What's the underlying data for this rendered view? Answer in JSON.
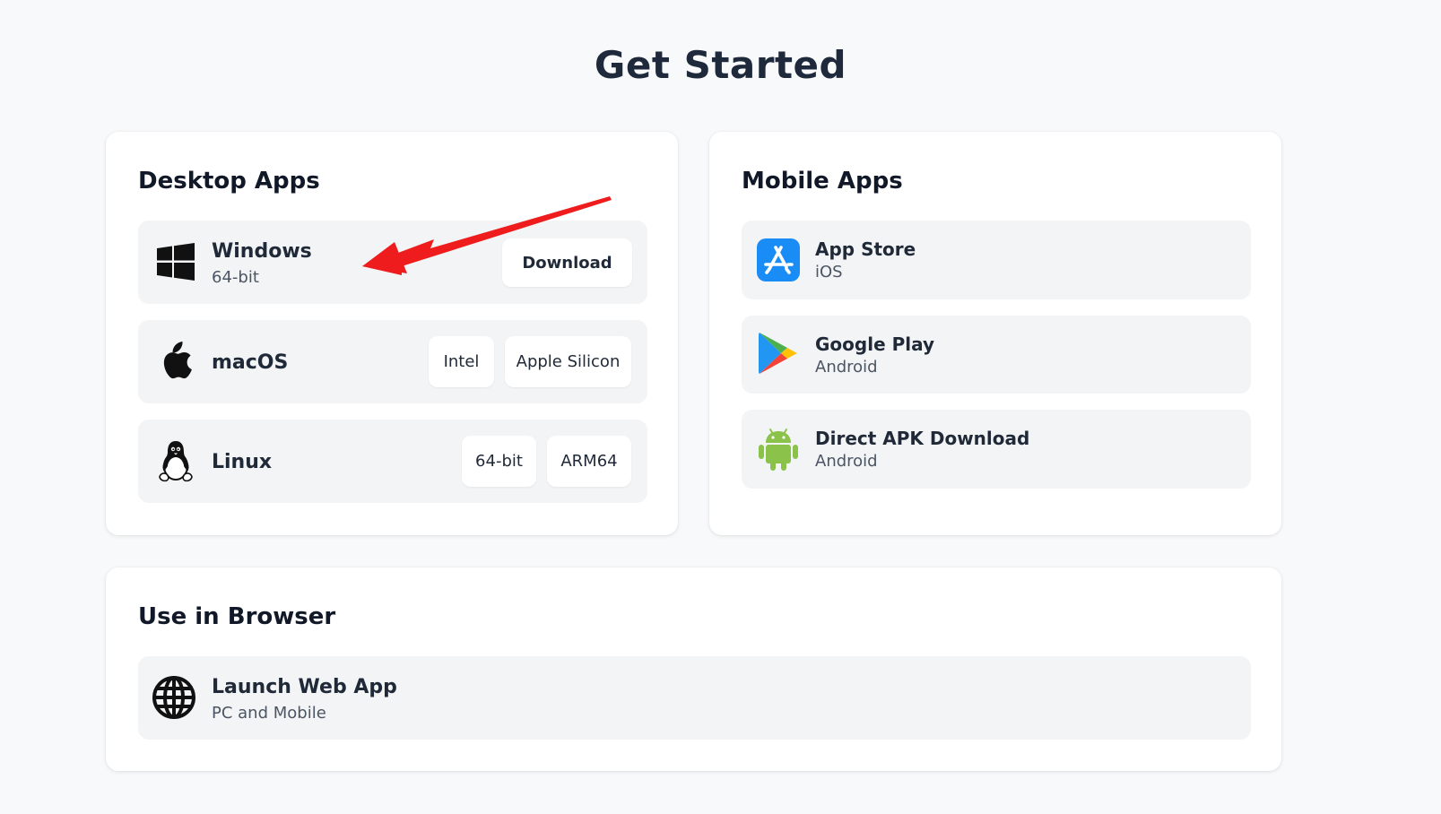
{
  "page": {
    "title": "Get Started"
  },
  "desktop": {
    "heading": "Desktop Apps",
    "windows": {
      "name": "Windows",
      "sub": "64-bit",
      "icon": "windows-icon",
      "button": "Download"
    },
    "macos": {
      "name": "macOS",
      "icon": "apple-icon",
      "buttons": [
        "Intel",
        "Apple Silicon"
      ]
    },
    "linux": {
      "name": "Linux",
      "icon": "linux-penguin-icon",
      "buttons": [
        "64-bit",
        "ARM64"
      ]
    }
  },
  "mobile": {
    "heading": "Mobile Apps",
    "items": [
      {
        "name": "App Store",
        "sub": "iOS",
        "icon": "app-store-icon"
      },
      {
        "name": "Google Play",
        "sub": "Android",
        "icon": "google-play-icon"
      },
      {
        "name": "Direct APK Download",
        "sub": "Android",
        "icon": "android-icon"
      }
    ]
  },
  "browser": {
    "heading": "Use in Browser",
    "item": {
      "name": "Launch Web App",
      "sub": "PC and Mobile",
      "icon": "globe-icon"
    }
  },
  "colors": {
    "background": "#f8f9fa",
    "card": "#ffffff",
    "row": "#f3f4f6",
    "annotation_arrow": "#ee1c1c",
    "app_store_blue": "#1a8cf6",
    "android_green": "#8bc34a"
  }
}
